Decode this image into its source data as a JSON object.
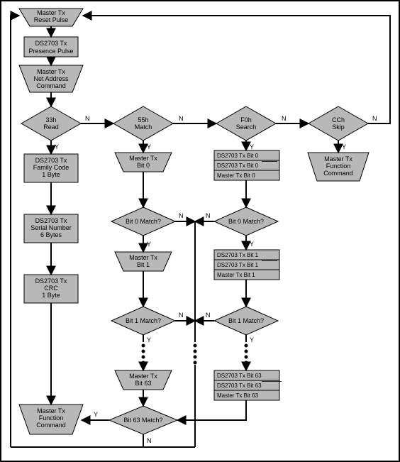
{
  "nodes": {
    "reset": {
      "l1": "Master Tx",
      "l2": "Reset Pulse"
    },
    "presence": {
      "l1": "DS2703 Tx",
      "l2": "Presence Pulse"
    },
    "netaddr": {
      "l1": "Master Tx",
      "l2": "Net Address",
      "l3": "Command"
    },
    "d33h": {
      "l1": "33h",
      "l2": "Read"
    },
    "d55h": {
      "l1": "55h",
      "l2": "Match"
    },
    "df0h": {
      "l1": "F0h",
      "l2": "Search"
    },
    "dcch": {
      "l1": "CCh",
      "l2": "Skip"
    },
    "family": {
      "l1": "DS2703 Tx",
      "l2": "Family Code",
      "l3": "1 Byte"
    },
    "serial": {
      "l1": "DS2703 Tx",
      "l2": "Serial Number",
      "l3": "6 Bytes"
    },
    "crc": {
      "l1": "DS2703 Tx",
      "l2": "CRC",
      "l3": "1 Byte"
    },
    "mbit0": {
      "l1": "Master Tx",
      "l2": "Bit 0"
    },
    "mbit1": {
      "l1": "Master Tx",
      "l2": "Bit 1"
    },
    "mbit63": {
      "l1": "Master Tx",
      "l2": "Bit 63"
    },
    "b0match": {
      "l1": "Bit 0 Match?"
    },
    "b1match": {
      "l1": "Bit 1 Match?"
    },
    "b63match": {
      "l1": "Bit 63 Match?"
    },
    "sbits0": {
      "a": "DS2703 Tx Bit 0",
      "b": "DS2703 Tx Bit 0",
      "c": "Master Tx Bit 0"
    },
    "sbits1": {
      "a": "DS2703 Tx Bit 1",
      "b": "DS2703 Tx Bit 1",
      "c": "Master Tx Bit 1"
    },
    "sbits63": {
      "a": "DS2703 Tx Bit 63",
      "b": "DS2703 Tx Bit 63",
      "c": "Master Tx Bit 63"
    },
    "sb0match": {
      "l1": "Bit 0 Match?"
    },
    "sb1match": {
      "l1": "Bit 1 Match?"
    },
    "func1": {
      "l1": "Master Tx",
      "l2": "Function",
      "l3": "Command"
    },
    "func2": {
      "l1": "Master Tx",
      "l2": "Function",
      "l3": "Command"
    }
  },
  "edges": {
    "Y": "Y",
    "N": "N"
  }
}
